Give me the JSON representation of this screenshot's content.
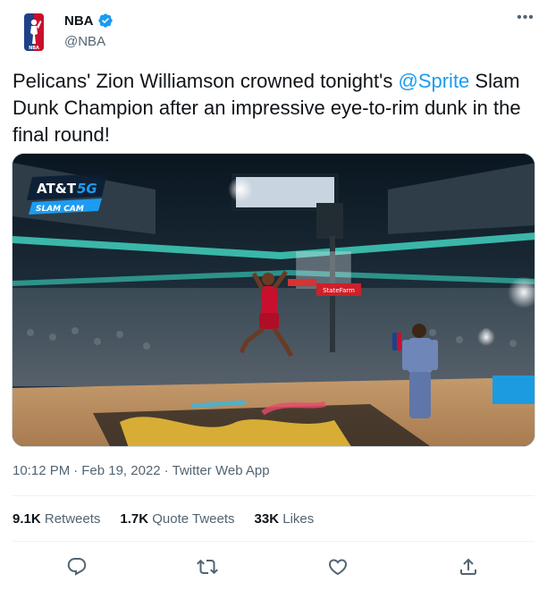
{
  "author": {
    "name": "NBA",
    "handle": "@NBA",
    "logo": "nba-logo",
    "verified": true
  },
  "tweet": {
    "text_before": "Pelicans' Zion Williamson crowned tonight's ",
    "mention": "@Sprite",
    "text_after": " Slam Dunk Champion after an impressive eye-to-rim dunk in the final round!"
  },
  "media": {
    "overlay_brand": "AT&T",
    "overlay_5g": "5G",
    "overlay_cam": "SLAM CAM",
    "sponsor_board": "StateFarm"
  },
  "meta": {
    "time": "10:12 PM",
    "sep1": "·",
    "date": "Feb 19, 2022",
    "sep2": "·",
    "source": "Twitter Web App"
  },
  "stats": {
    "retweets_count": "9.1K",
    "retweets_label": "Retweets",
    "quotes_count": "1.7K",
    "quotes_label": "Quote Tweets",
    "likes_count": "33K",
    "likes_label": "Likes"
  },
  "actions": [
    "reply-icon",
    "retweet-icon",
    "like-icon",
    "share-icon"
  ],
  "colors": {
    "accent": "#1d9bf0",
    "nba_blue": "#1d428a",
    "nba_red": "#c8102e",
    "secondary_text": "#536471"
  }
}
